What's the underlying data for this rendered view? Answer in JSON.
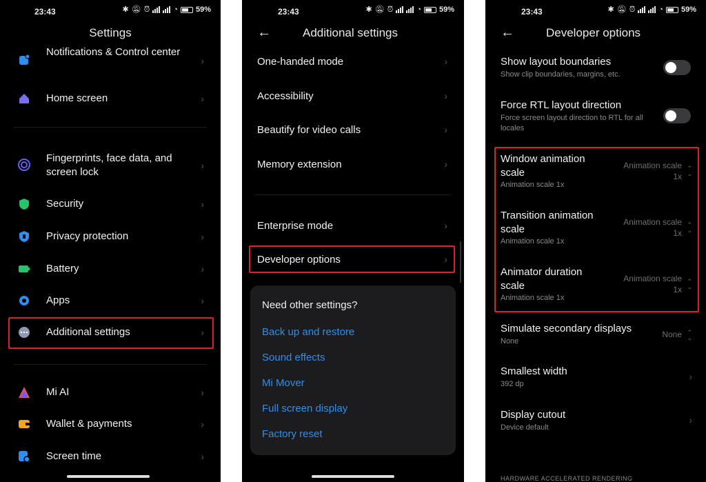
{
  "status": {
    "time": "23:43",
    "battery": "59%"
  },
  "screen1": {
    "title": "Settings",
    "items": [
      {
        "label": "Notifications & Control center",
        "icon": "notifications-icon",
        "color": "#2d8ff0"
      },
      {
        "label": "Home screen",
        "icon": "home-icon",
        "color": "#7b6cf6"
      },
      {
        "label": "Fingerprints, face data, and screen lock",
        "icon": "fingerprint-icon",
        "color": "#6a5cf5"
      },
      {
        "label": "Security",
        "icon": "security-shield-icon",
        "color": "#27c26c"
      },
      {
        "label": "Privacy protection",
        "icon": "privacy-icon",
        "color": "#2d8ff0"
      },
      {
        "label": "Battery",
        "icon": "battery-icon",
        "color": "#27c26c"
      },
      {
        "label": "Apps",
        "icon": "apps-gear-icon",
        "color": "#2d8ff0"
      },
      {
        "label": "Additional settings",
        "icon": "more-dots-icon",
        "color": "#8e9ab5"
      },
      {
        "label": "Mi AI",
        "icon": "mi-ai-icon",
        "color": "#e0506a"
      },
      {
        "label": "Wallet & payments",
        "icon": "wallet-icon",
        "color": "#f2a81d"
      },
      {
        "label": "Screen time",
        "icon": "screen-time-icon",
        "color": "#2d8ff0"
      }
    ]
  },
  "screen2": {
    "title": "Additional settings",
    "items": [
      {
        "label": "One-handed mode"
      },
      {
        "label": "Accessibility"
      },
      {
        "label": "Beautify for video calls"
      },
      {
        "label": "Memory extension"
      },
      {
        "label": "Enterprise mode"
      },
      {
        "label": "Developer options"
      }
    ],
    "card": {
      "title": "Need other settings?",
      "links": [
        "Back up and restore",
        "Sound effects",
        "Mi Mover",
        "Full screen display",
        "Factory reset"
      ]
    }
  },
  "screen3": {
    "title": "Developer options",
    "layout_bounds": {
      "title": "Show layout boundaries",
      "sub": "Show clip boundaries, margins, etc."
    },
    "rtl": {
      "title": "Force RTL layout direction",
      "sub": "Force screen layout direction to RTL for all locales"
    },
    "window_anim": {
      "title": "Window animation scale",
      "sub": "Animation scale 1x",
      "value": "Animation scale 1x"
    },
    "transition_anim": {
      "title": "Transition animation scale",
      "sub": "Animation scale 1x",
      "value": "Animation scale 1x"
    },
    "animator_duration": {
      "title": "Animator duration scale",
      "sub": "Animation scale 1x",
      "value": "Animation scale 1x"
    },
    "secondary_displays": {
      "title": "Simulate secondary displays",
      "sub": "None",
      "value": "None"
    },
    "smallest_width": {
      "title": "Smallest width",
      "sub": "392 dp"
    },
    "display_cutout": {
      "title": "Display cutout",
      "sub": "Device default"
    },
    "section_caption": "HARDWARE ACCELERATED RENDERING"
  },
  "colors": {
    "highlight": "#d3232c",
    "link": "#2d8ff0",
    "background": "#000000"
  }
}
